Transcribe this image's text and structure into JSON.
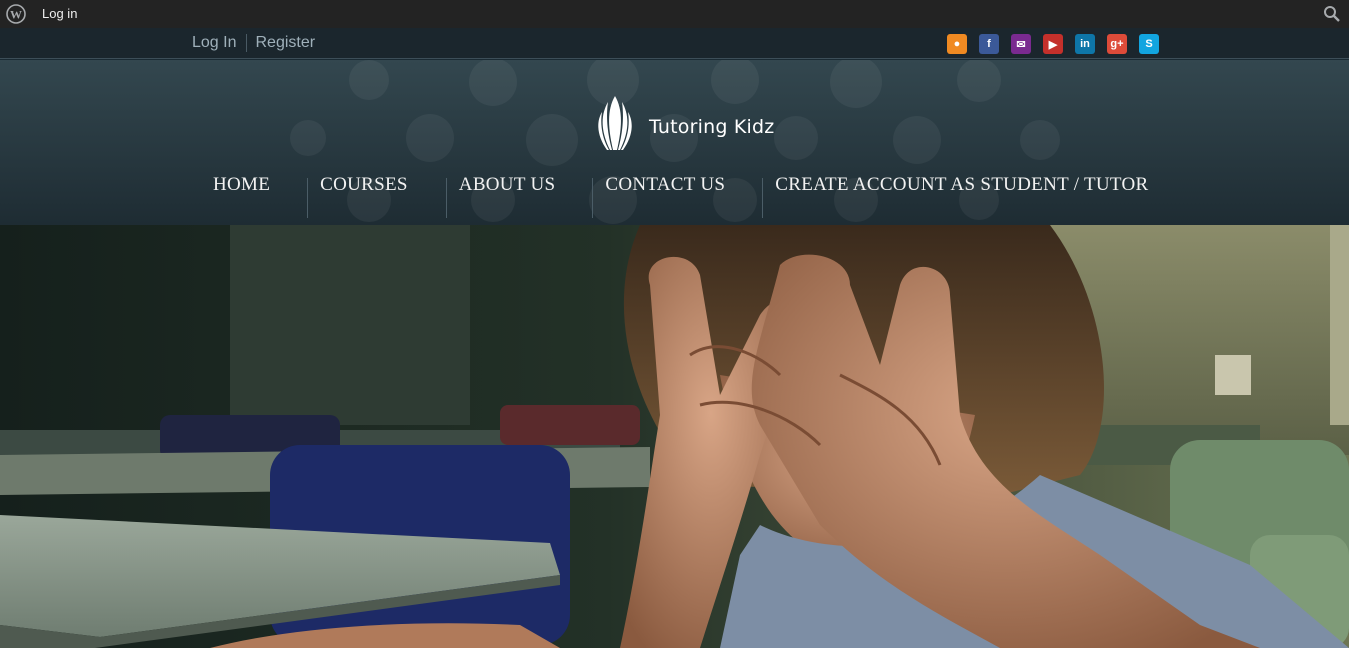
{
  "adminbar": {
    "login_label": "Log in"
  },
  "topbar": {
    "login_link": "Log In",
    "register_link": "Register",
    "social_icons": [
      {
        "name": "rss-icon",
        "glyph": "●",
        "color": "#f08a22"
      },
      {
        "name": "facebook-icon",
        "glyph": "f",
        "color": "#3b5998"
      },
      {
        "name": "email-icon",
        "glyph": "✉",
        "color": "#7a2a90"
      },
      {
        "name": "youtube-icon",
        "glyph": "▶",
        "color": "#c4302b"
      },
      {
        "name": "linkedin-icon",
        "glyph": "in",
        "color": "#0e76a8"
      },
      {
        "name": "googleplus-icon",
        "glyph": "g+",
        "color": "#dd4b39"
      },
      {
        "name": "skype-icon",
        "glyph": "S",
        "color": "#12a5e0"
      }
    ]
  },
  "header": {
    "brand": "Tutoring Kidz",
    "nav": [
      {
        "label": "HOME"
      },
      {
        "label": "COURSES"
      },
      {
        "label": "ABOUT US"
      },
      {
        "label": "CONTACT US"
      },
      {
        "label": "CREATE ACCOUNT AS STUDENT / TUTOR"
      }
    ]
  },
  "hero": {
    "image": "stressed-student-photo"
  }
}
